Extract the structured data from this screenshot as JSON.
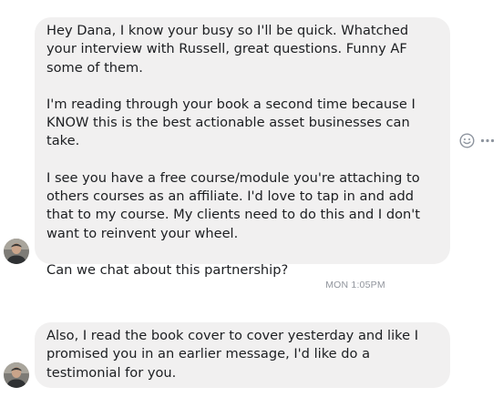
{
  "messages": [
    {
      "paragraphs": [
        "Hey Dana, I know your busy so I'll be quick. Whatched  your interview with Russell, great questions. Funny AF some of them.",
        "I'm reading through your book a second time because I KNOW this is the best actionable asset businesses can take.",
        "I see you have a free course/module you're attaching to others courses as an affiliate. I'd love to tap in and add that to my course. My clients need to do this and I don't want to reinvent your wheel.",
        "Can we chat about this partnership?"
      ]
    },
    {
      "paragraphs": [
        "Also, I read the book cover to cover yesterday and like I promised you in an earlier message, I'd like do a testimonial for you."
      ]
    }
  ],
  "timestamp": "MON 1:05PM",
  "icons": {
    "emoji": "smiley-face-icon",
    "more": "more-options-icon"
  },
  "colors": {
    "bubble": "#f1f0f0",
    "timestamp": "#90949c",
    "icon": "#8d949e"
  }
}
